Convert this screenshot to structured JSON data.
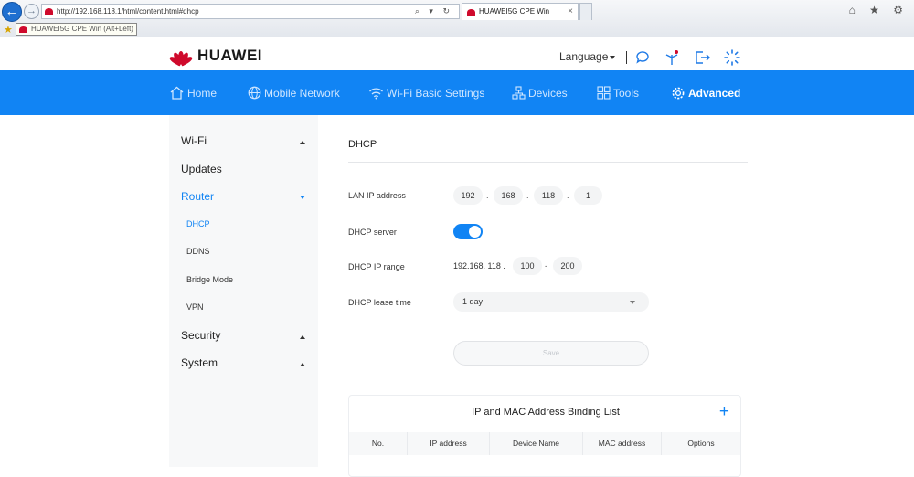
{
  "browser": {
    "url": "http://192.168.118.1/html/content.html#dhcp",
    "tab_title": "HUAWEI5G CPE Win",
    "tooltip": "HUAWEI5G CPE Win (Alt+Left)",
    "back_glyph": "←",
    "forward_glyph": "→",
    "close_glyph": "×",
    "addr_icons": "⌕ ▾ ↻",
    "right_icons": "⌂ ★ ⚙"
  },
  "header": {
    "brand": "HUAWEI",
    "language_label": "Language",
    "icons": [
      "chat-icon",
      "antenna-icon",
      "logout-icon",
      "loading-icon"
    ]
  },
  "nav": {
    "items": [
      {
        "label": "Home",
        "icon": "home-icon"
      },
      {
        "label": "Mobile Network",
        "icon": "globe-icon"
      },
      {
        "label": "Wi-Fi Basic Settings",
        "icon": "wifi-icon"
      },
      {
        "label": "Devices",
        "icon": "devices-icon"
      },
      {
        "label": "Tools",
        "icon": "tools-icon"
      },
      {
        "label": "Advanced",
        "icon": "gear-icon",
        "active": true
      }
    ]
  },
  "sidebar": {
    "sections": [
      {
        "label": "Wi-Fi"
      },
      {
        "label": "Updates"
      },
      {
        "label": "Router",
        "active": true
      },
      {
        "label": "Security"
      },
      {
        "label": "System"
      }
    ],
    "router_sub": [
      {
        "label": "DHCP",
        "active": true
      },
      {
        "label": "DDNS"
      },
      {
        "label": "Bridge Mode"
      },
      {
        "label": "VPN"
      }
    ]
  },
  "main": {
    "title": "DHCP",
    "lan_ip_label": "LAN IP address",
    "lan_ip": [
      "192",
      "168",
      "118",
      "1"
    ],
    "dhcp_server_label": "DHCP server",
    "dhcp_server_on": true,
    "ip_range_label": "DHCP IP range",
    "ip_range_prefix": "192.168. 118 .",
    "ip_range_start": "100",
    "ip_range_end": "200",
    "lease_label": "DHCP lease time",
    "lease_value": "1 day",
    "save_label": "Save",
    "dot": ".",
    "dash": "-"
  },
  "binding": {
    "title": "IP and MAC Address Binding List",
    "add_glyph": "+",
    "columns": [
      "No.",
      "IP address",
      "Device Name",
      "MAC address",
      "Options"
    ]
  },
  "colors": {
    "brand_red": "#cf0a2c",
    "nav_blue": "#1184f4"
  }
}
